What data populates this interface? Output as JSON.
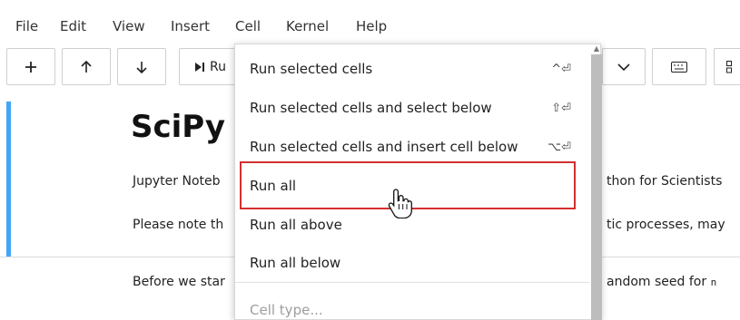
{
  "menubar": {
    "items": [
      "File",
      "Edit",
      "View",
      "Insert",
      "Cell",
      "Kernel",
      "Help"
    ]
  },
  "toolbar": {
    "add_icon": "plus-icon",
    "move_up_icon": "arrow-up-icon",
    "move_down_icon": "arrow-down-icon",
    "run_icon": "run-icon",
    "run_label": "Ru",
    "dropdown_icon": "chevron-down-icon",
    "keyboard_icon": "keyboard-icon"
  },
  "notebook": {
    "title": "SciPy",
    "line1_left": "Jupyter Noteb",
    "line1_right": "thon for Scientists",
    "line2_left": "Please note th",
    "line2_right": "tic processes, may",
    "line3_left": "Before we star",
    "line3_right": "andom seed for",
    "line3_code": "n"
  },
  "cell_menu": {
    "items": [
      {
        "label": "Run selected cells",
        "shortcut": "^⏎"
      },
      {
        "label": "Run selected cells and select below",
        "shortcut": "⇧⏎"
      },
      {
        "label": "Run selected cells and insert cell below",
        "shortcut": "⌥⏎"
      },
      {
        "label": "Run all",
        "shortcut": ""
      },
      {
        "label": "Run all above",
        "shortcut": ""
      },
      {
        "label": "Run all below",
        "shortcut": ""
      },
      {
        "label": "Cell type...",
        "shortcut": ""
      }
    ],
    "highlight_color": "#d32f2f"
  },
  "colors": {
    "cell_accent": "#42a5f5"
  }
}
